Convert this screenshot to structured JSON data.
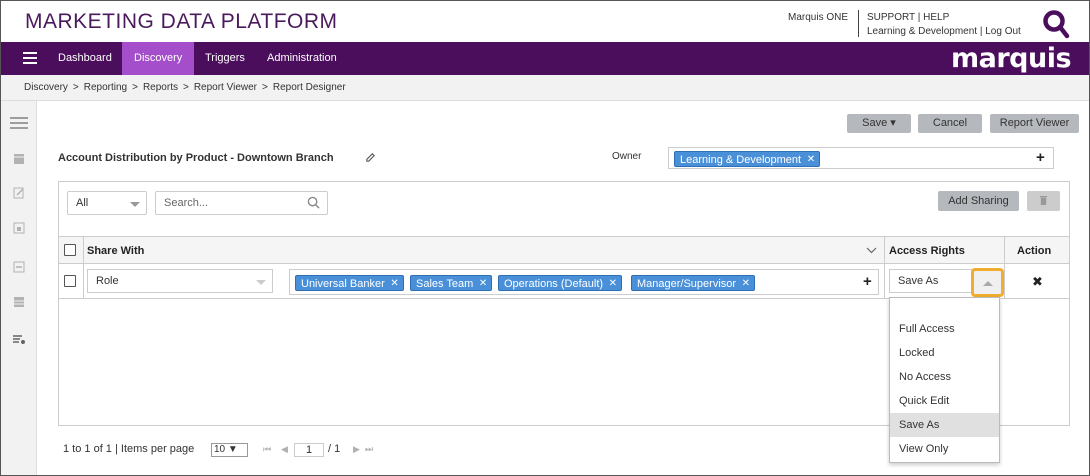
{
  "header": {
    "app_title": "MARKETING DATA PLATFORM",
    "user_name": "Marquis ONE",
    "support_label": "SUPPORT",
    "help_label": "HELP",
    "org_label": "Learning & Development",
    "logout_label": "Log Out",
    "brand": "marquis"
  },
  "nav": {
    "items": [
      {
        "label": "Dashboard"
      },
      {
        "label": "Discovery"
      },
      {
        "label": "Triggers"
      },
      {
        "label": "Administration"
      }
    ],
    "active": "Discovery"
  },
  "breadcrumb": [
    "Discovery",
    "Reporting",
    "Reports",
    "Report Viewer",
    "Report Designer"
  ],
  "toolbar": {
    "save_label": "Save",
    "cancel_label": "Cancel",
    "report_viewer_label": "Report Viewer"
  },
  "report": {
    "title": "Account Distribution by Product - Downtown Branch",
    "owner_label": "Owner",
    "owner_value": "Learning & Development"
  },
  "sharing": {
    "filter_value": "All",
    "search_placeholder": "Search...",
    "add_sharing_label": "Add Sharing",
    "columns": {
      "share_with": "Share With",
      "access_rights": "Access Rights",
      "action": "Action"
    },
    "row": {
      "type": "Role",
      "roles": [
        "Universal Banker",
        "Sales Team",
        "Operations (Default)",
        "Manager/Supervisor"
      ],
      "access": "Save As"
    },
    "access_options": [
      "Full Access",
      "Locked",
      "No Access",
      "Quick Edit",
      "Save As",
      "View Only"
    ],
    "selected_option": "Save As"
  },
  "pager": {
    "summary": "1 to 1 of 1 | Items per page",
    "per_page": "10",
    "page": "1",
    "of_pages": "/ 1"
  },
  "colors": {
    "nav_bg": "#4a0e5c",
    "nav_active": "#a44ecb",
    "chip_blue": "#4a90d9",
    "highlight": "#f0ad2e"
  }
}
